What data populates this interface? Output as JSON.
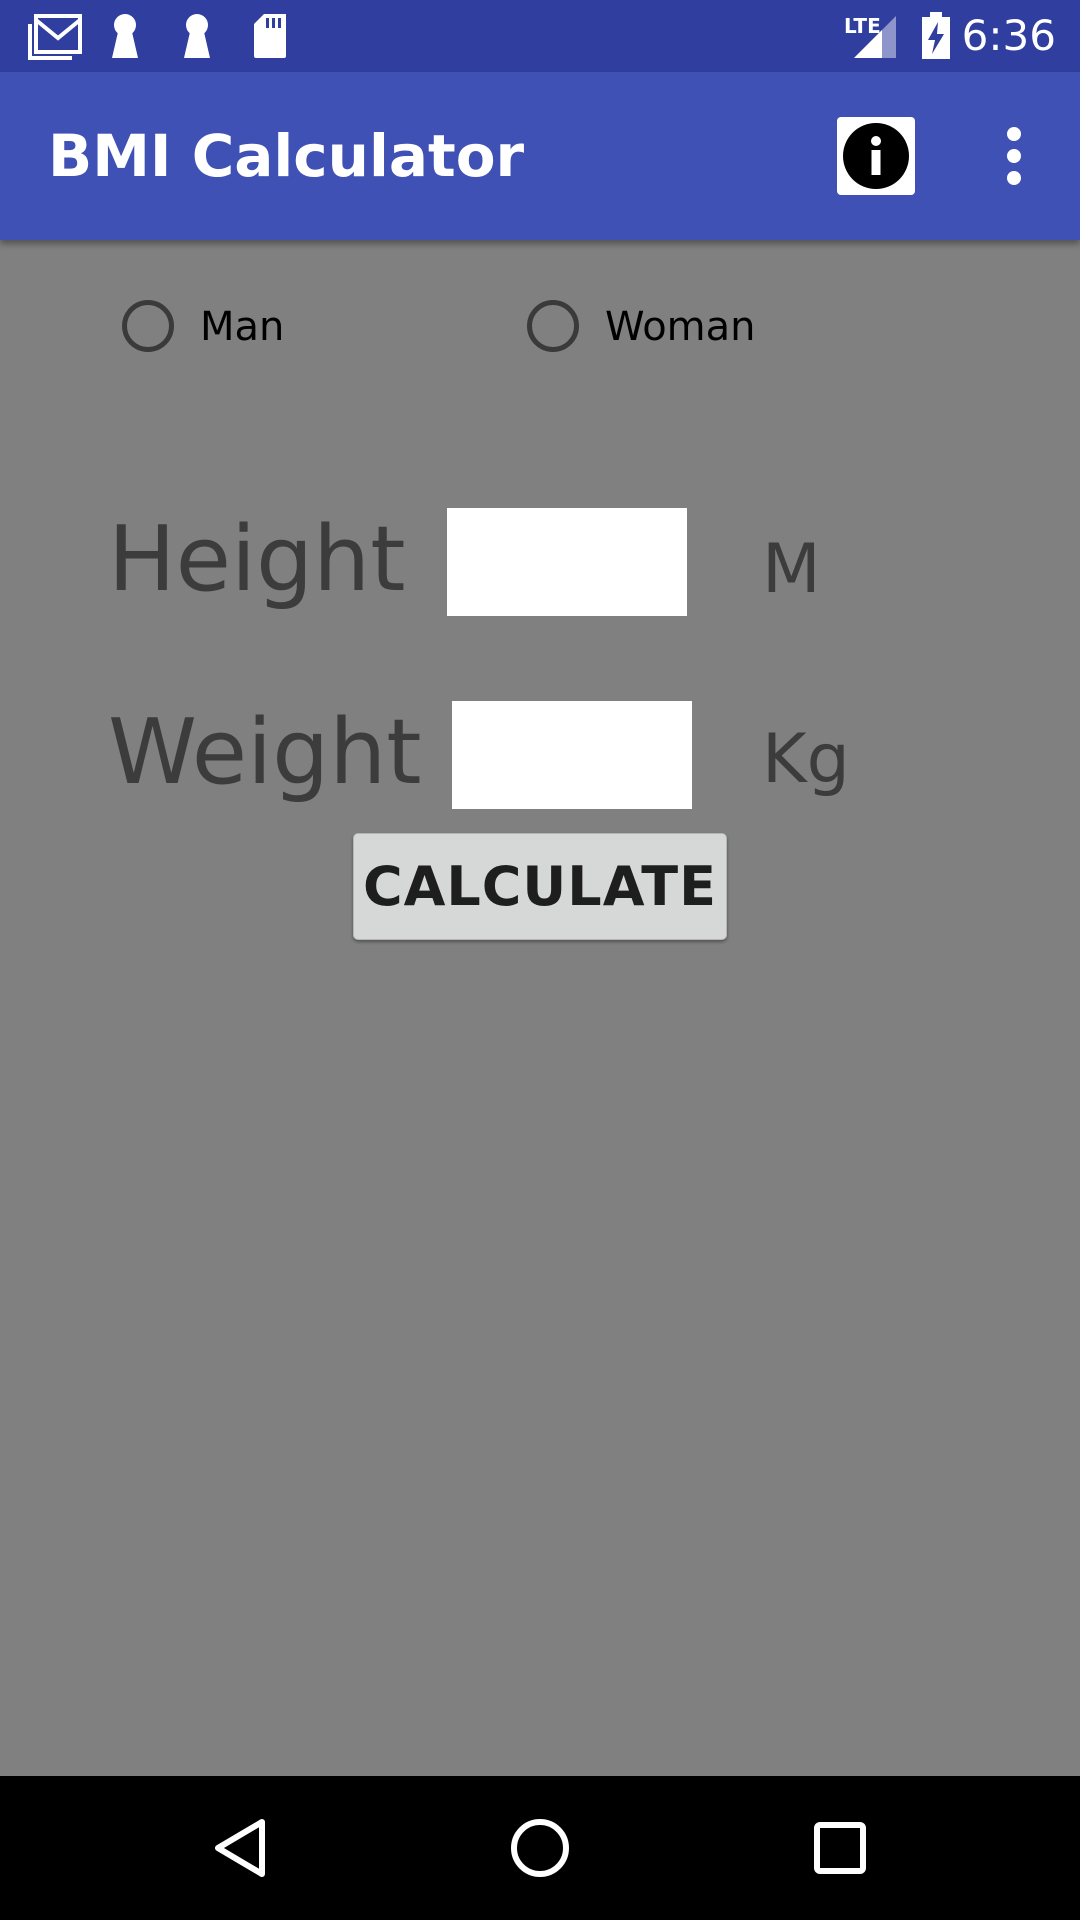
{
  "status_bar": {
    "time": "6:36",
    "network": "LTE",
    "icons": [
      "gmail-icon",
      "keyhole-icon",
      "keyhole-icon",
      "sd-card-icon",
      "signal-icon",
      "battery-charging-icon"
    ]
  },
  "app_bar": {
    "title": "BMI Calculator",
    "actions": [
      "info-icon",
      "overflow-menu-icon"
    ]
  },
  "gender": {
    "options": [
      {
        "label": "Man",
        "selected": false
      },
      {
        "label": "Woman",
        "selected": false
      }
    ]
  },
  "form": {
    "height": {
      "label": "Height",
      "value": "",
      "unit": "M"
    },
    "weight": {
      "label": "Weight",
      "value": "",
      "unit": "Kg"
    },
    "calculate_label": "CALCULATE"
  },
  "nav_bar": {
    "buttons": [
      "back-icon",
      "home-icon",
      "recents-icon"
    ]
  },
  "colors": {
    "status_bar": "#303F9F",
    "app_bar": "#3F51B5",
    "background": "#808080",
    "button": "#D6D7D7",
    "input": "#FFFFFF"
  }
}
